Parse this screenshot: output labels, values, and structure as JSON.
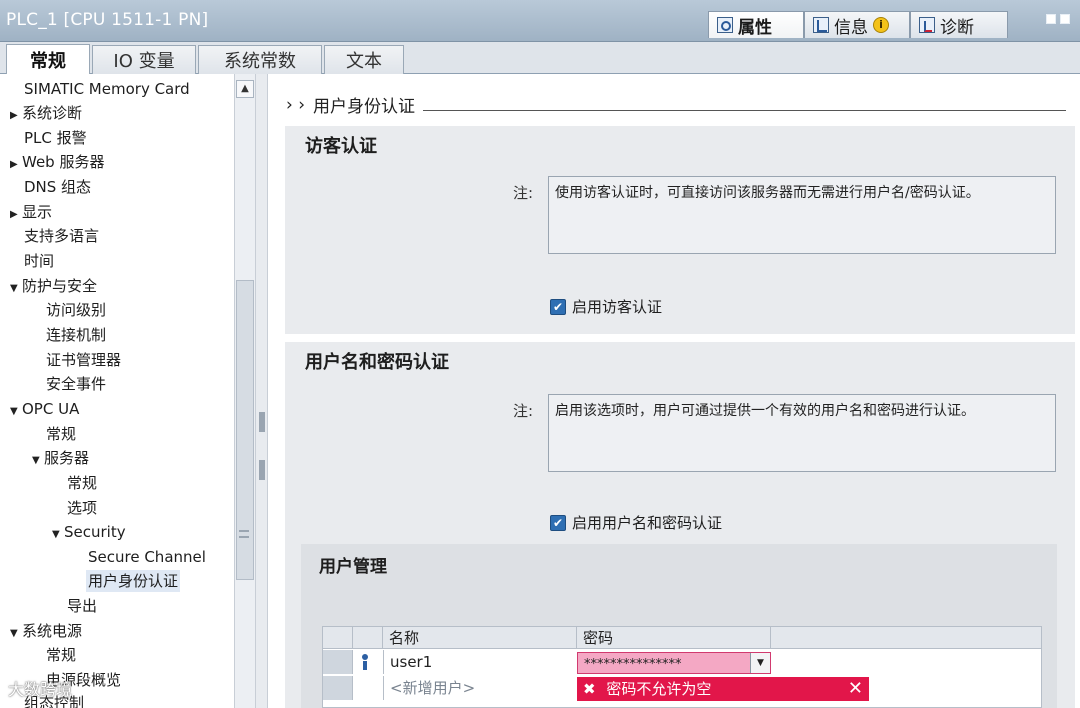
{
  "window": {
    "title": "PLC_1 [CPU 1511-1 PN]",
    "tabs": [
      {
        "label": "属性",
        "icon": "properties-icon"
      },
      {
        "label": "信息",
        "icon": "info-icon"
      },
      {
        "label": "诊断",
        "icon": "diagnostics-icon"
      }
    ],
    "info_badge": "i"
  },
  "subtabs": [
    "常规",
    "IO 变量",
    "系统常数",
    "文本"
  ],
  "nav": {
    "items": [
      {
        "label": "SIMATIC Memory Card"
      },
      {
        "label": "系统诊断",
        "caret": "▶"
      },
      {
        "label": "PLC 报警"
      },
      {
        "label": "Web 服务器",
        "caret": "▶"
      },
      {
        "label": "DNS 组态"
      },
      {
        "label": "显示",
        "caret": "▶"
      },
      {
        "label": "支持多语言"
      },
      {
        "label": "时间"
      },
      {
        "label": "防护与安全",
        "caret": "▼"
      },
      {
        "label": "访问级别"
      },
      {
        "label": "连接机制"
      },
      {
        "label": "证书管理器"
      },
      {
        "label": "安全事件"
      },
      {
        "label": "OPC UA",
        "caret": "▼"
      },
      {
        "label": "常规"
      },
      {
        "label": "服务器",
        "caret": "▼"
      },
      {
        "label": "常规"
      },
      {
        "label": "选项"
      },
      {
        "label": "Security",
        "caret": "▼"
      },
      {
        "label": "Secure Channel"
      },
      {
        "label": "用户身份认证"
      },
      {
        "label": "导出"
      },
      {
        "label": "系统电源",
        "caret": "▼"
      },
      {
        "label": "常规"
      },
      {
        "label": "电源段概览"
      },
      {
        "label": "组态控制"
      }
    ]
  },
  "main": {
    "breadcrumb": "用户身份认证",
    "guest": {
      "title": "访客认证",
      "note_label": "注:",
      "note": "使用访客认证时，可直接访问该服务器而无需进行用户名/密码认证。",
      "checkbox": "启用访客认证"
    },
    "userpass": {
      "title": "用户名和密码认证",
      "note_label": "注:",
      "note": "启用该选项时，用户可通过提供一个有效的用户名和密码进行认证。",
      "checkbox": "启用用户名和密码认证"
    },
    "user_mgmt": {
      "title": "用户管理",
      "columns": [
        "名称",
        "密码"
      ],
      "rows": [
        {
          "name": "user1",
          "password": "***************"
        }
      ],
      "new_user": "<新增用户>",
      "error": "密码不允许为空"
    }
  },
  "watermark": "大数跨境"
}
